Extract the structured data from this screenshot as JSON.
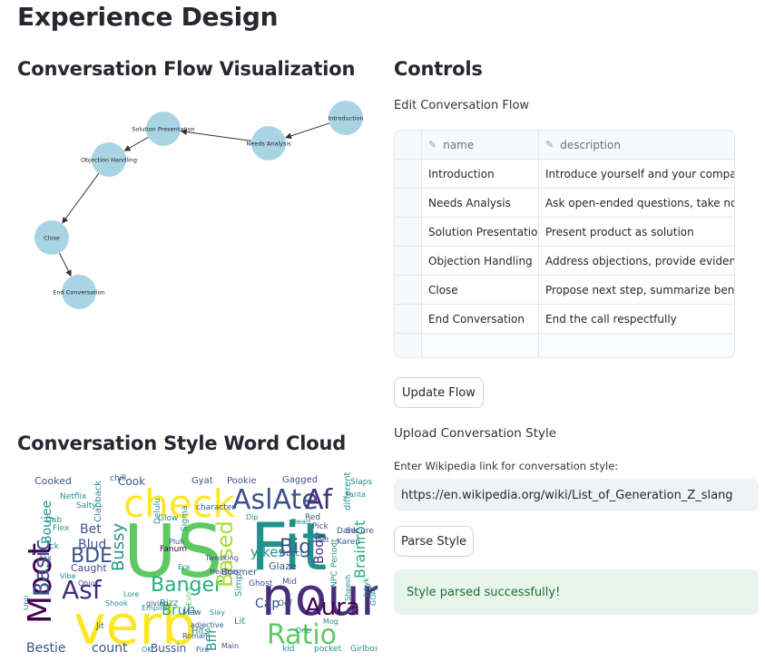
{
  "page": {
    "title": "Experience Design"
  },
  "flow_section": {
    "title": "Conversation Flow Visualization",
    "nodes": [
      "Introduction",
      "Needs Analysis",
      "Solution Presentation",
      "Objection Handling",
      "Close",
      "End Conversation"
    ]
  },
  "controls": {
    "title": "Controls",
    "edit_label": "Edit Conversation Flow",
    "table": {
      "columns": [
        "name",
        "description"
      ],
      "rows": [
        [
          "Introduction",
          "Introduce yourself and your company"
        ],
        [
          "Needs Analysis",
          "Ask open-ended questions, take notes"
        ],
        [
          "Solution Presentation",
          "Present product as solution"
        ],
        [
          "Objection Handling",
          "Address objections, provide evidence"
        ],
        [
          "Close",
          "Propose next step, summarize benefits"
        ],
        [
          "End Conversation",
          "End the call respectfully"
        ],
        [
          "",
          ""
        ]
      ]
    },
    "update_button": "Update Flow",
    "upload_label": "Upload Conversation Style",
    "wiki_label": "Enter Wikipedia link for conversation style:",
    "wiki_value": "https://en.wikipedia.org/wiki/List_of_Generation_Z_slang",
    "parse_button": "Parse Style",
    "success_message": "Style parsed successfully!"
  },
  "wordcloud": {
    "title": "Conversation Style Word Cloud",
    "words": [
      "Fit",
      "US",
      "verb",
      "noun",
      "check",
      "Moot",
      "Ratio",
      "AslAte",
      "Af",
      "Aura",
      "Basic",
      "Banger",
      "Asf",
      "BDE",
      "Based",
      "Big",
      "Bussy",
      "yikes",
      "Boujee",
      "Bet",
      "Blud",
      "Bruh",
      "Body",
      "Brainrot",
      "Bestie",
      "count",
      "Bussin",
      "Cooked",
      "Cook",
      "Caught",
      "Cap",
      "Bffr",
      "Lit",
      "Hits",
      "Rizz",
      "Glaze",
      "Gucci",
      "character",
      "Pookie",
      "Gyat",
      "Gagged",
      "Clapback",
      "Salty",
      "Netflix",
      "Dab",
      "Flex",
      "Ick",
      "Extra",
      "Sigma",
      "Glow",
      "Delulu",
      "Fanum",
      "Boomer",
      "Red",
      "Pick",
      "Dank",
      "Karen",
      "Ghost",
      "Simp",
      "Mid",
      "NPC",
      "Periodt",
      "Secure",
      "different",
      "kid",
      "pocket",
      "Girlboss",
      "Main",
      "Fire",
      "adjective",
      "Roman",
      "OK",
      "Mew",
      "Opp",
      "Jit",
      "chill",
      "Empire",
      "Sheesh",
      "Iykyk",
      "4K",
      "GOAT",
      "Slaps",
      "Oof",
      "Pluh",
      "giving",
      "tax",
      "Tweaking",
      "Yeet",
      "Dead",
      "Slay",
      "Shook",
      "Dip",
      "Ohio",
      "Drip",
      "Fanta",
      "Era",
      "Heather",
      "Lore",
      "Mog",
      "Vibe",
      "Tea",
      "Stan",
      "Sus",
      "Cringe",
      "Woke",
      "Cheugy"
    ]
  }
}
